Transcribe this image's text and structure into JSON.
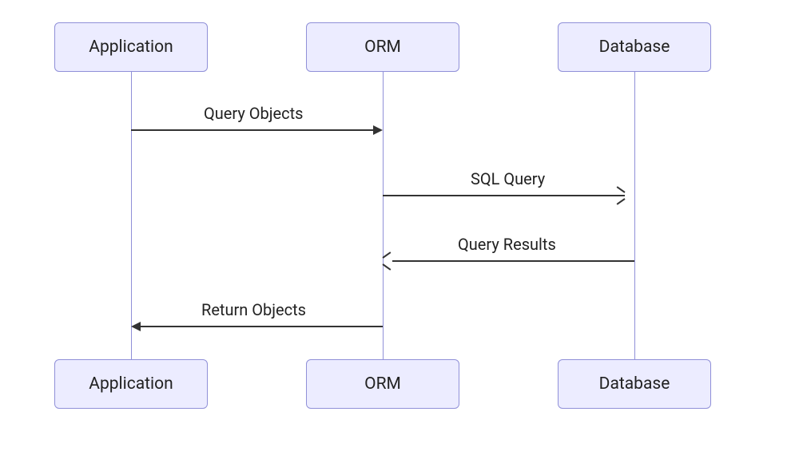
{
  "diagram": {
    "type": "sequence",
    "participants": [
      {
        "id": "application",
        "label": "Application"
      },
      {
        "id": "orm",
        "label": "ORM"
      },
      {
        "id": "database",
        "label": "Database"
      }
    ],
    "messages": [
      {
        "from": "application",
        "to": "orm",
        "label": "Query Objects",
        "direction": "right"
      },
      {
        "from": "orm",
        "to": "database",
        "label": "SQL Query",
        "direction": "right"
      },
      {
        "from": "database",
        "to": "orm",
        "label": "Query Results",
        "direction": "left"
      },
      {
        "from": "orm",
        "to": "application",
        "label": "Return Objects",
        "direction": "left"
      }
    ],
    "colors": {
      "box_fill": "#ECECFF",
      "box_border": "#9090D8",
      "lifeline": "#9090D8",
      "arrow": "#333333",
      "text": "#222222"
    }
  }
}
